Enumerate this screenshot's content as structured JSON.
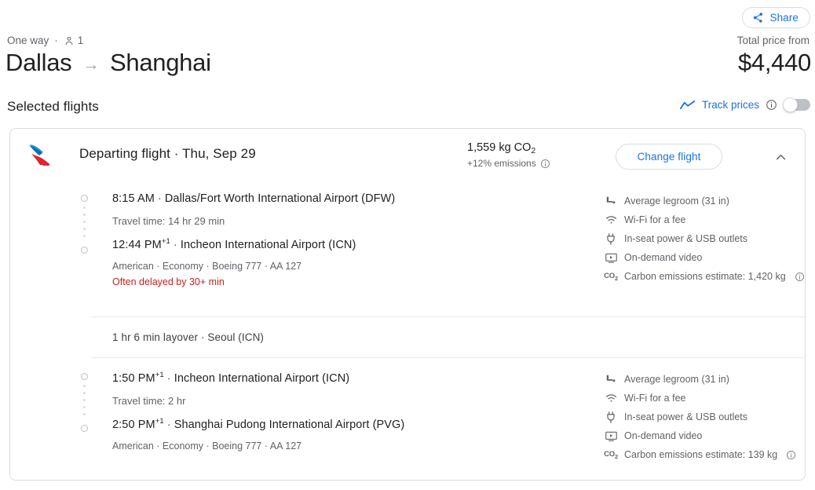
{
  "header": {
    "share_label": "Share",
    "share_icon": "share-icon",
    "trip_type": "One way",
    "separator": "·",
    "passenger_icon": "person-icon",
    "passenger_count": "1",
    "origin": "Dallas",
    "route_arrow": "→",
    "destination": "Shanghai",
    "total_price_label": "Total price from",
    "total_price": "$4,440",
    "section_title": "Selected flights",
    "track_prices_label": "Track prices",
    "track_prices_icon": "trending-up-icon",
    "track_prices_info_icon": "info-icon",
    "track_prices_toggle_state": "off",
    "accent_blue": "#1a73e8",
    "text_primary": "#202124",
    "text_secondary": "#5f6368"
  },
  "flight_card": {
    "airline_logo": "american-airlines-logo",
    "title": "Departing flight · Thu, Sep 29",
    "emissions_total": "1,559 kg CO",
    "emissions_subscript": "2",
    "emissions_delta": "+12% emissions",
    "emissions_info_icon": "info-icon",
    "change_flight_label": "Change flight",
    "collapse_icon": "chevron-up-icon",
    "legs": [
      {
        "depart_time": "8:15 AM",
        "depart_day_offset": "",
        "depart_airport": "Dallas/Fort Worth International Airport (DFW)",
        "travel_time": "Travel time: 14 hr 29 min",
        "arrive_time": "12:44 PM",
        "arrive_day_offset": "+1",
        "arrive_airport": "Incheon International Airport (ICN)",
        "meta": "American · Economy · Boeing 777 · AA 127",
        "warning": "Often delayed by 30+ min",
        "amenities": [
          {
            "icon": "legroom-icon",
            "label": "Average legroom (31 in)"
          },
          {
            "icon": "wifi-icon",
            "label": "Wi-Fi for a fee"
          },
          {
            "icon": "power-plug-icon",
            "label": "In-seat power & USB outlets"
          },
          {
            "icon": "video-icon",
            "label": "On-demand video"
          },
          {
            "icon": "co2-icon",
            "label": "Carbon emissions estimate: 1,420 kg",
            "info_icon": "info-icon"
          }
        ]
      },
      {
        "depart_time": "1:50 PM",
        "depart_day_offset": "+1",
        "depart_airport": "Incheon International Airport (ICN)",
        "travel_time": "Travel time: 2 hr",
        "arrive_time": "2:50 PM",
        "arrive_day_offset": "+1",
        "arrive_airport": "Shanghai Pudong International Airport (PVG)",
        "meta": "American · Economy · Boeing 777 · AA 127",
        "warning": "",
        "amenities": [
          {
            "icon": "legroom-icon",
            "label": "Average legroom (31 in)"
          },
          {
            "icon": "wifi-icon",
            "label": "Wi-Fi for a fee"
          },
          {
            "icon": "power-plug-icon",
            "label": "In-seat power & USB outlets"
          },
          {
            "icon": "video-icon",
            "label": "On-demand video"
          },
          {
            "icon": "co2-icon",
            "label": "Carbon emissions estimate: 139 kg",
            "info_icon": "info-icon"
          }
        ]
      }
    ],
    "layover": "1 hr 6 min layover · Seoul (ICN)"
  }
}
